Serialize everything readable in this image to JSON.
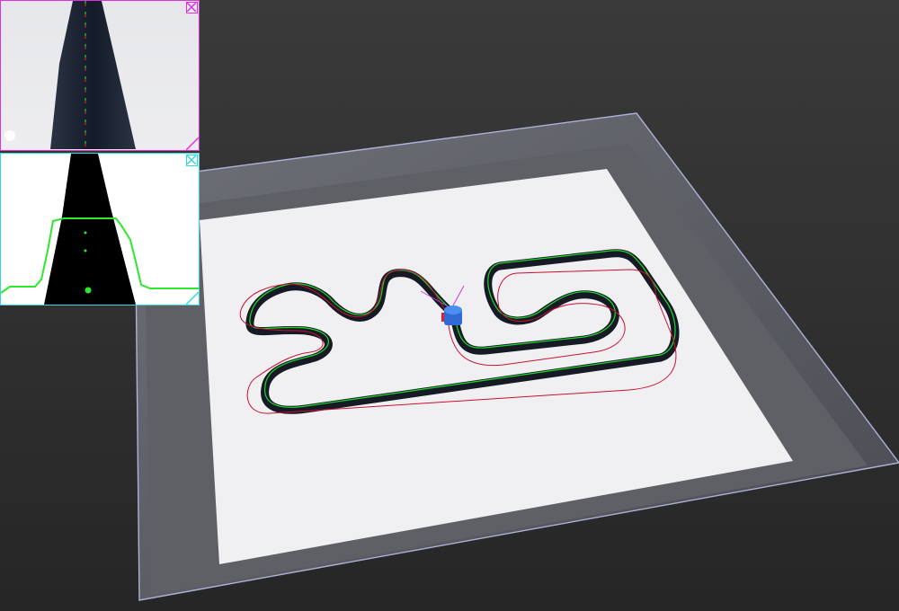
{
  "viewport": {
    "background_top": "#3a3a3a",
    "background_bottom": "#262626"
  },
  "floor": {
    "mat_color": "#f0f0f3",
    "border_color": "#5f6066",
    "wall_color": "#8a8c96",
    "edge_color": "#aeb2d8"
  },
  "track": {
    "line_color": "#151a24",
    "guide_color": "#21d62a",
    "trail_color": "#cc1030"
  },
  "robot": {
    "body_color": "#2f6ad6",
    "top_color": "#4c8ef0",
    "marker_color": "#e0202a",
    "sensor_ray_color": "#c040e0"
  },
  "overlays": {
    "camera_view": {
      "border_color": "#e030e0",
      "close_icon": "close-x-icon",
      "resize_icon": "resize-corner-icon"
    },
    "threshold_view": {
      "border_color": "#30d8e0",
      "close_icon": "close-x-icon",
      "resize_icon": "resize-corner-icon",
      "profile_color": "#2ee82e"
    }
  }
}
